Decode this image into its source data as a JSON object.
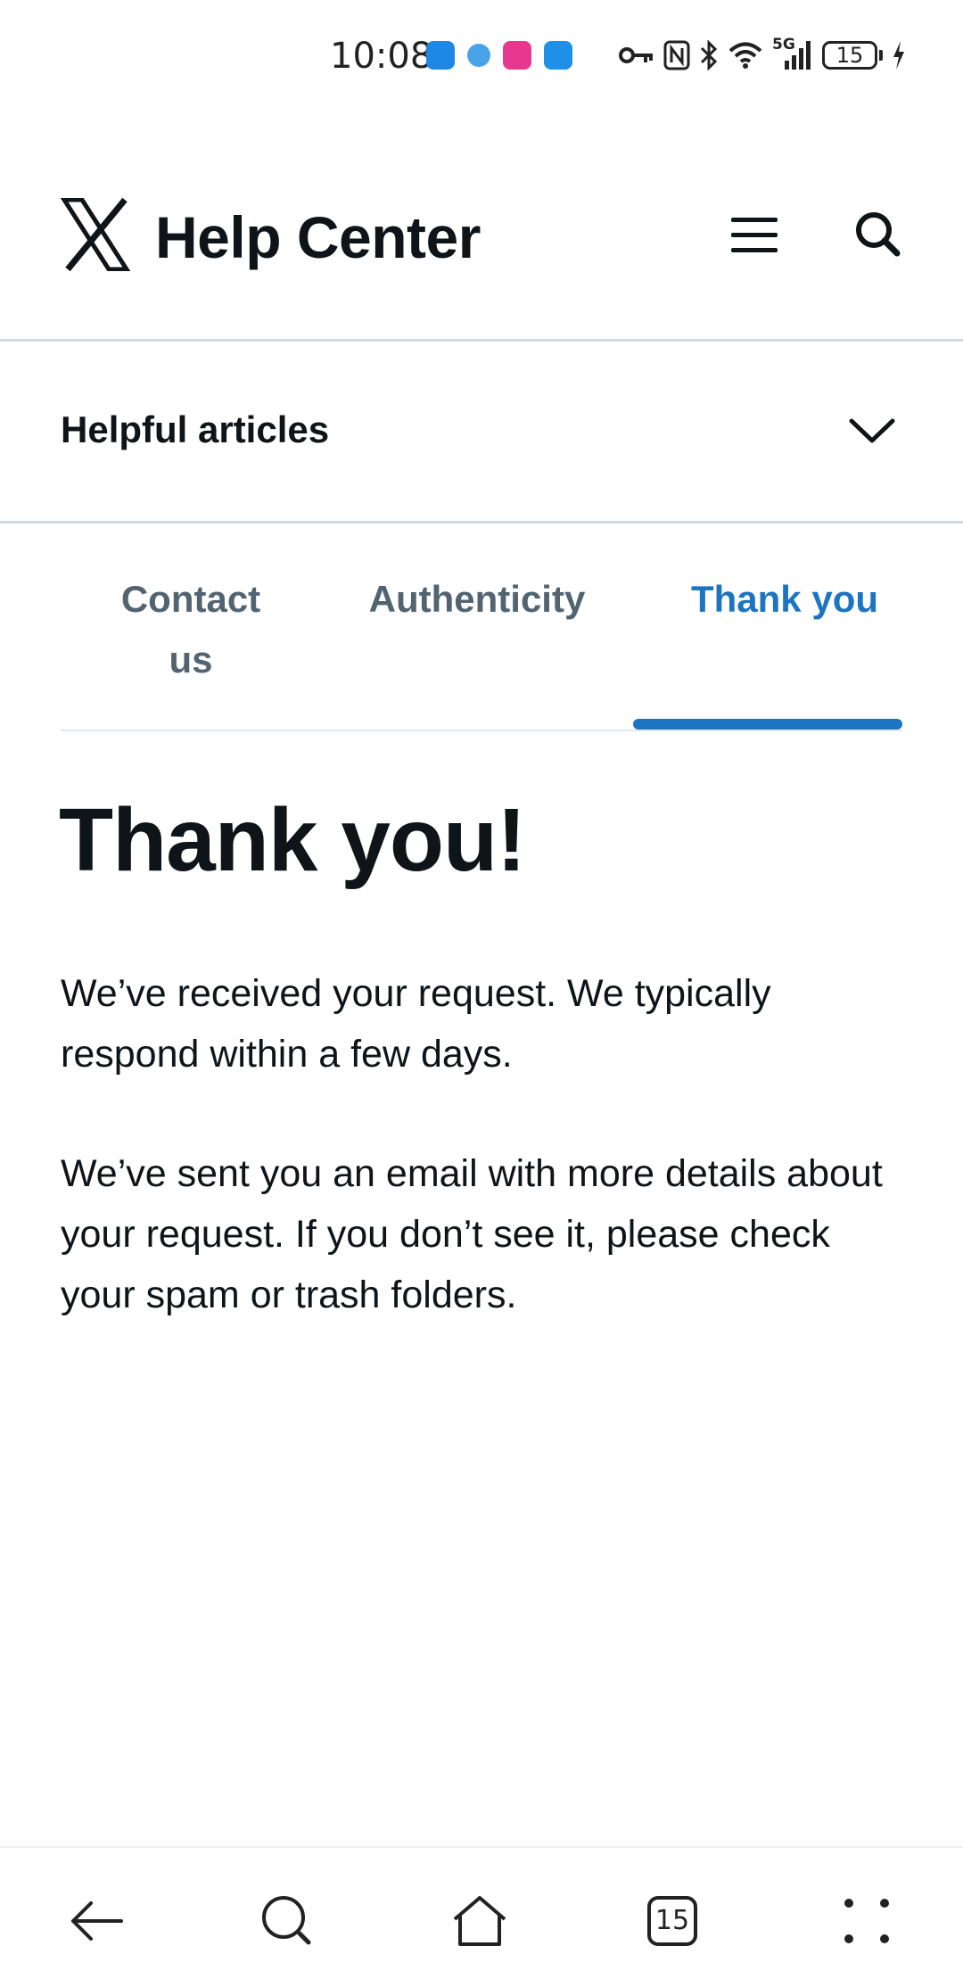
{
  "status_bar": {
    "time": "10:08",
    "network": "5G",
    "battery": "15"
  },
  "header": {
    "brand_title": "Help Center",
    "logo": "x-logo-icon",
    "menu_icon": "hamburger-menu-icon",
    "search_icon": "search-icon"
  },
  "helpful_articles": {
    "label": "Helpful articles",
    "icon": "chevron-down-icon"
  },
  "tabs": [
    {
      "line1": "Contact",
      "line2": "us"
    },
    {
      "label": "Authenticity"
    },
    {
      "label": "Thank you",
      "active": true
    }
  ],
  "main": {
    "title": "Thank you!",
    "paragraph_1": "We’ve received your request. We typically respond within a few days.",
    "paragraph_2": "We’ve sent you an email with more details about your request. If you don’t see it, please check your spam or trash folders."
  },
  "bottom_nav": {
    "tab_count": "15",
    "icons": [
      "back-arrow-icon",
      "search-icon",
      "home-icon",
      "tabs-icon",
      "more-icon"
    ]
  },
  "colors": {
    "accent": "#1d75c2",
    "text_primary": "#0f1419",
    "text_secondary": "#536471",
    "divider": "#cfd9de"
  }
}
